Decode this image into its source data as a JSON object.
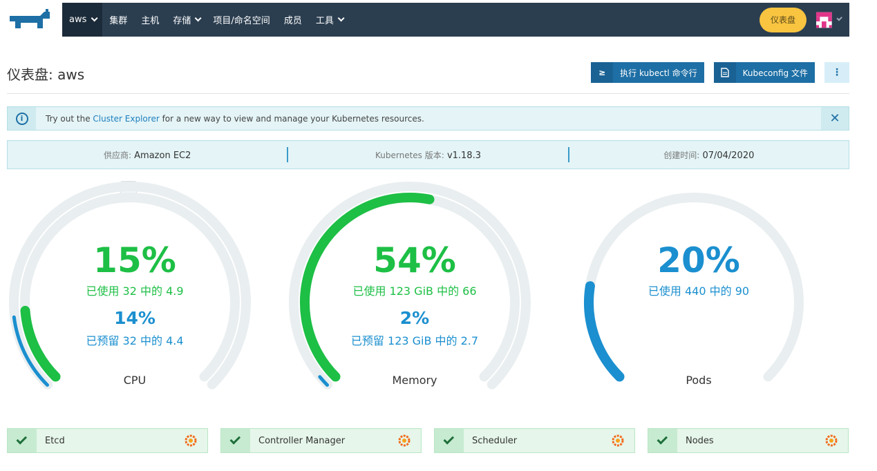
{
  "header": {
    "cluster": "aws",
    "nav": [
      "集群",
      "主机",
      "存储",
      "项目/命名空间",
      "成员",
      "工具"
    ],
    "dashboard_button": "仪表盘"
  },
  "page": {
    "title": "仪表盘: aws",
    "kubectl_button": "执行 kubectl 命令行",
    "kubeconfig_button": "Kubeconfig 文件"
  },
  "banner": {
    "prefix": "Try out the ",
    "link": "Cluster Explorer",
    "suffix": " for a new way to view and manage your Kubernetes resources."
  },
  "info": {
    "provider_label": "供应商:",
    "provider": "Amazon EC2",
    "k8s_label": "Kubernetes 版本:",
    "k8s": "v1.18.3",
    "created_label": "创建时间:",
    "created": "07/04/2020"
  },
  "gauges": [
    {
      "name": "CPU",
      "used_pct": "15%",
      "used_text": "已使用 32 中的 4.9",
      "reserved_pct": "14%",
      "reserved_text": "已预留 32 中的 4.4",
      "used_fraction": 0.15,
      "reserved_fraction": 0.14
    },
    {
      "name": "Memory",
      "used_pct": "54%",
      "used_text": "已使用 123 GiB 中的 66",
      "reserved_pct": "2%",
      "reserved_text": "已预留 123 GiB 中的 2.7",
      "used_fraction": 0.54,
      "reserved_fraction": 0.02
    },
    {
      "name": "Pods",
      "used_pct": "20%",
      "used_text": "已使用 440 中的 90",
      "used_fraction": 0.2
    }
  ],
  "components": [
    "Etcd",
    "Controller Manager",
    "Scheduler",
    "Nodes"
  ],
  "colors": {
    "nav_bg": "#2b3e50",
    "accent_blue": "#1d6fa5",
    "used_green": "#1dbf45",
    "reserved_blue": "#1b8fcf",
    "dashboard_yellow": "#f9c440"
  }
}
